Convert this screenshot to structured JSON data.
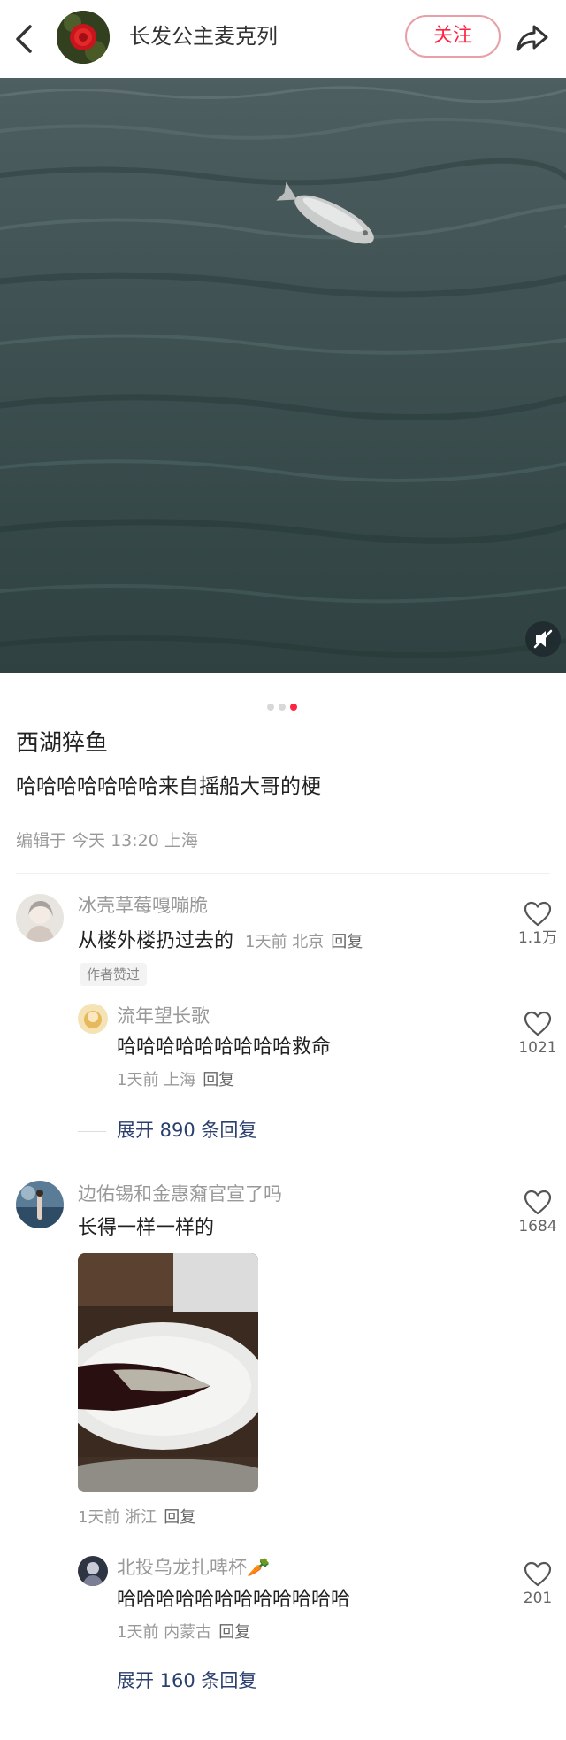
{
  "header": {
    "author_name": "长发公主麦克列",
    "follow_label": "关注"
  },
  "post": {
    "carousel_total": 3,
    "carousel_active": 3,
    "title": "西湖猝鱼",
    "body": "哈哈哈哈哈哈哈来自摇船大哥的梗",
    "meta": "编辑于 今天 13:20 上海"
  },
  "comments": [
    {
      "name": "冰壳草莓嘎嘣脆",
      "text": "从楼外楼扔过去的",
      "time": "1天前 北京",
      "reply_label": "回复",
      "tag": "作者赞过",
      "likes": "1.1万",
      "replies": [
        {
          "name": "流年望长歌",
          "text": "哈哈哈哈哈哈哈哈哈救命",
          "time": "1天前 上海",
          "reply_label": "回复",
          "likes": "1021"
        }
      ],
      "expand_label": "展开 890 条回复"
    },
    {
      "name": "边佑锡和金惠奫官宣了吗",
      "text": "长得一样一样的",
      "time": "1天前 浙江",
      "reply_label": "回复",
      "likes": "1684",
      "replies": [
        {
          "name": "北投乌龙扎啤杯🥕",
          "text": "哈哈哈哈哈哈哈哈哈哈哈哈",
          "time": "1天前 内蒙古",
          "reply_label": "回复",
          "likes": "201"
        }
      ],
      "expand_label": "展开 160 条回复"
    }
  ],
  "colors": {
    "accent": "#ff2442",
    "link": "#2a3f6e"
  }
}
